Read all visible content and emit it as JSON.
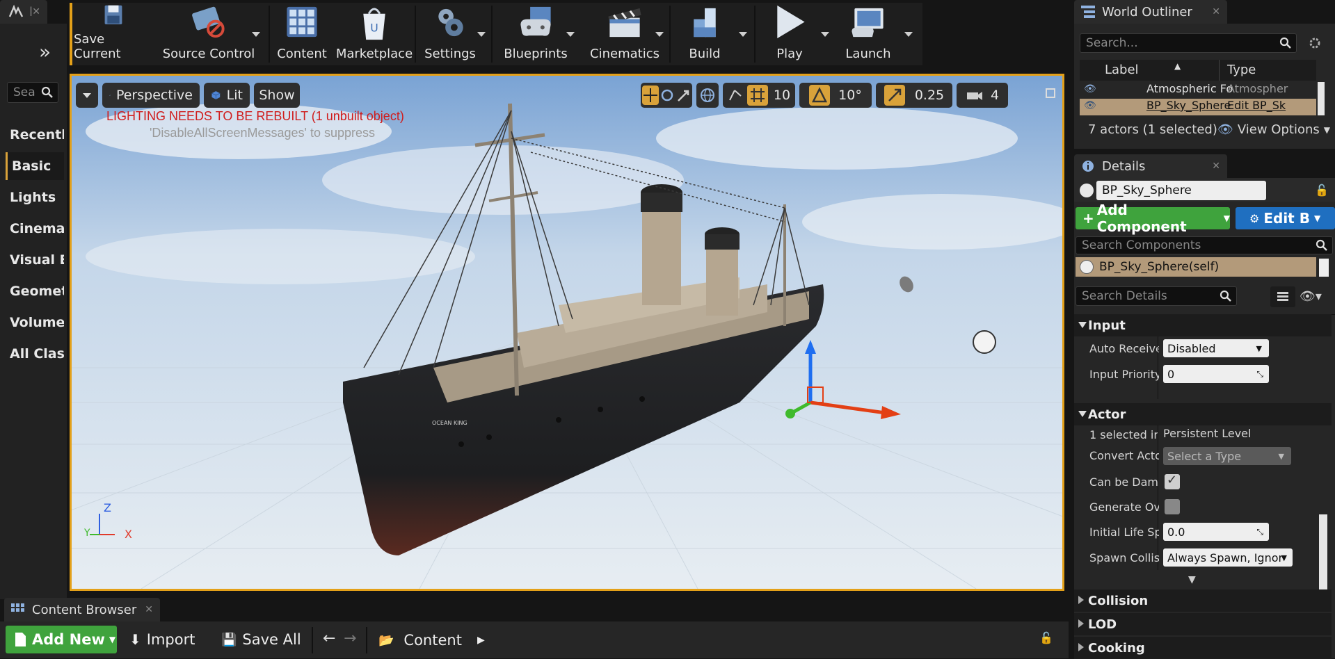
{
  "app_tab": {
    "label": "l"
  },
  "left_panel": {
    "search_placeholder": "Sea",
    "items": [
      {
        "label": "Recently"
      },
      {
        "label": "Basic"
      },
      {
        "label": "Lights"
      },
      {
        "label": "Cinemat"
      },
      {
        "label": "Visual Ef"
      },
      {
        "label": "Geometr"
      },
      {
        "label": "Volumes"
      },
      {
        "label": "All Class"
      }
    ]
  },
  "toolbar": {
    "buttons": [
      {
        "label": "Save Current",
        "icon": "save-icon"
      },
      {
        "label": "Source Control",
        "icon": "source-control-icon"
      },
      {
        "label": "Content",
        "icon": "content-icon"
      },
      {
        "label": "Marketplace",
        "icon": "marketplace-icon"
      },
      {
        "label": "Settings",
        "icon": "settings-icon"
      },
      {
        "label": "Blueprints",
        "icon": "blueprints-icon"
      },
      {
        "label": "Cinematics",
        "icon": "cinematics-icon"
      },
      {
        "label": "Build",
        "icon": "build-icon"
      },
      {
        "label": "Play",
        "icon": "play-icon"
      },
      {
        "label": "Launch",
        "icon": "launch-icon"
      }
    ]
  },
  "viewport": {
    "perspective_label": "Perspective",
    "lit_label": "Lit",
    "show_label": "Show",
    "grid_snap": "10",
    "rotation_snap": "10°",
    "scale_snap": "0.25",
    "camera_speed": "4",
    "warning": "LIGHTING NEEDS TO BE REBUILT (1 unbuilt object)",
    "suppress_hint": "'DisableAllScreenMessages' to suppress",
    "axis_z": "Z",
    "axis_x": "X",
    "axis_y": "Y",
    "hull_text": "OCEAN KING"
  },
  "world_outliner": {
    "tab_label": "World Outliner",
    "search_placeholder": "Search...",
    "col_label": "Label",
    "col_type": "Type",
    "rows": [
      {
        "label": "Atmospheric Fo",
        "type": "Atmospher"
      },
      {
        "label": "BP_Sky_Sphere",
        "type": "Edit BP_Sk"
      }
    ],
    "status": "7 actors (1 selected)",
    "view_options": "View Options"
  },
  "details": {
    "tab_label": "Details",
    "actor_name": "BP_Sky_Sphere",
    "add_component": "Add Component",
    "edit_bp": "Edit B",
    "search_components_placeholder": "Search Components",
    "component_self": "BP_Sky_Sphere(self)",
    "search_details_placeholder": "Search Details",
    "sections": {
      "input": "Input",
      "actor": "Actor",
      "collision": "Collision",
      "lod": "LOD",
      "cooking": "Cooking"
    },
    "props": {
      "auto_receive_label": "Auto Receive",
      "auto_receive_value": "Disabled",
      "input_priority_label": "Input Priority",
      "input_priority_value": "0",
      "selected_in_label": "1 selected ir",
      "selected_in_value": "Persistent Level",
      "convert_actor_label": "Convert Acto",
      "convert_actor_value": "Select a Type",
      "can_be_damaged_label": "Can be Dama",
      "can_be_damaged_checked": true,
      "generate_overlap_label": "Generate Ove",
      "generate_overlap_checked": false,
      "initial_life_label": "Initial Life Sp",
      "initial_life_value": "0.0",
      "spawn_collision_label": "Spawn Collis",
      "spawn_collision_value": "Always Spawn, Ignor"
    }
  },
  "content_browser": {
    "tab_label": "Content Browser",
    "add_new": "Add New",
    "import": "Import",
    "save_all": "Save All",
    "path": "Content"
  },
  "colors": {
    "accent_orange": "#e3a019",
    "add_green": "#3fa33d",
    "edit_blue": "#1f6fc0",
    "warning_red": "#d01d1d",
    "selected_row": "#b39a7a"
  }
}
